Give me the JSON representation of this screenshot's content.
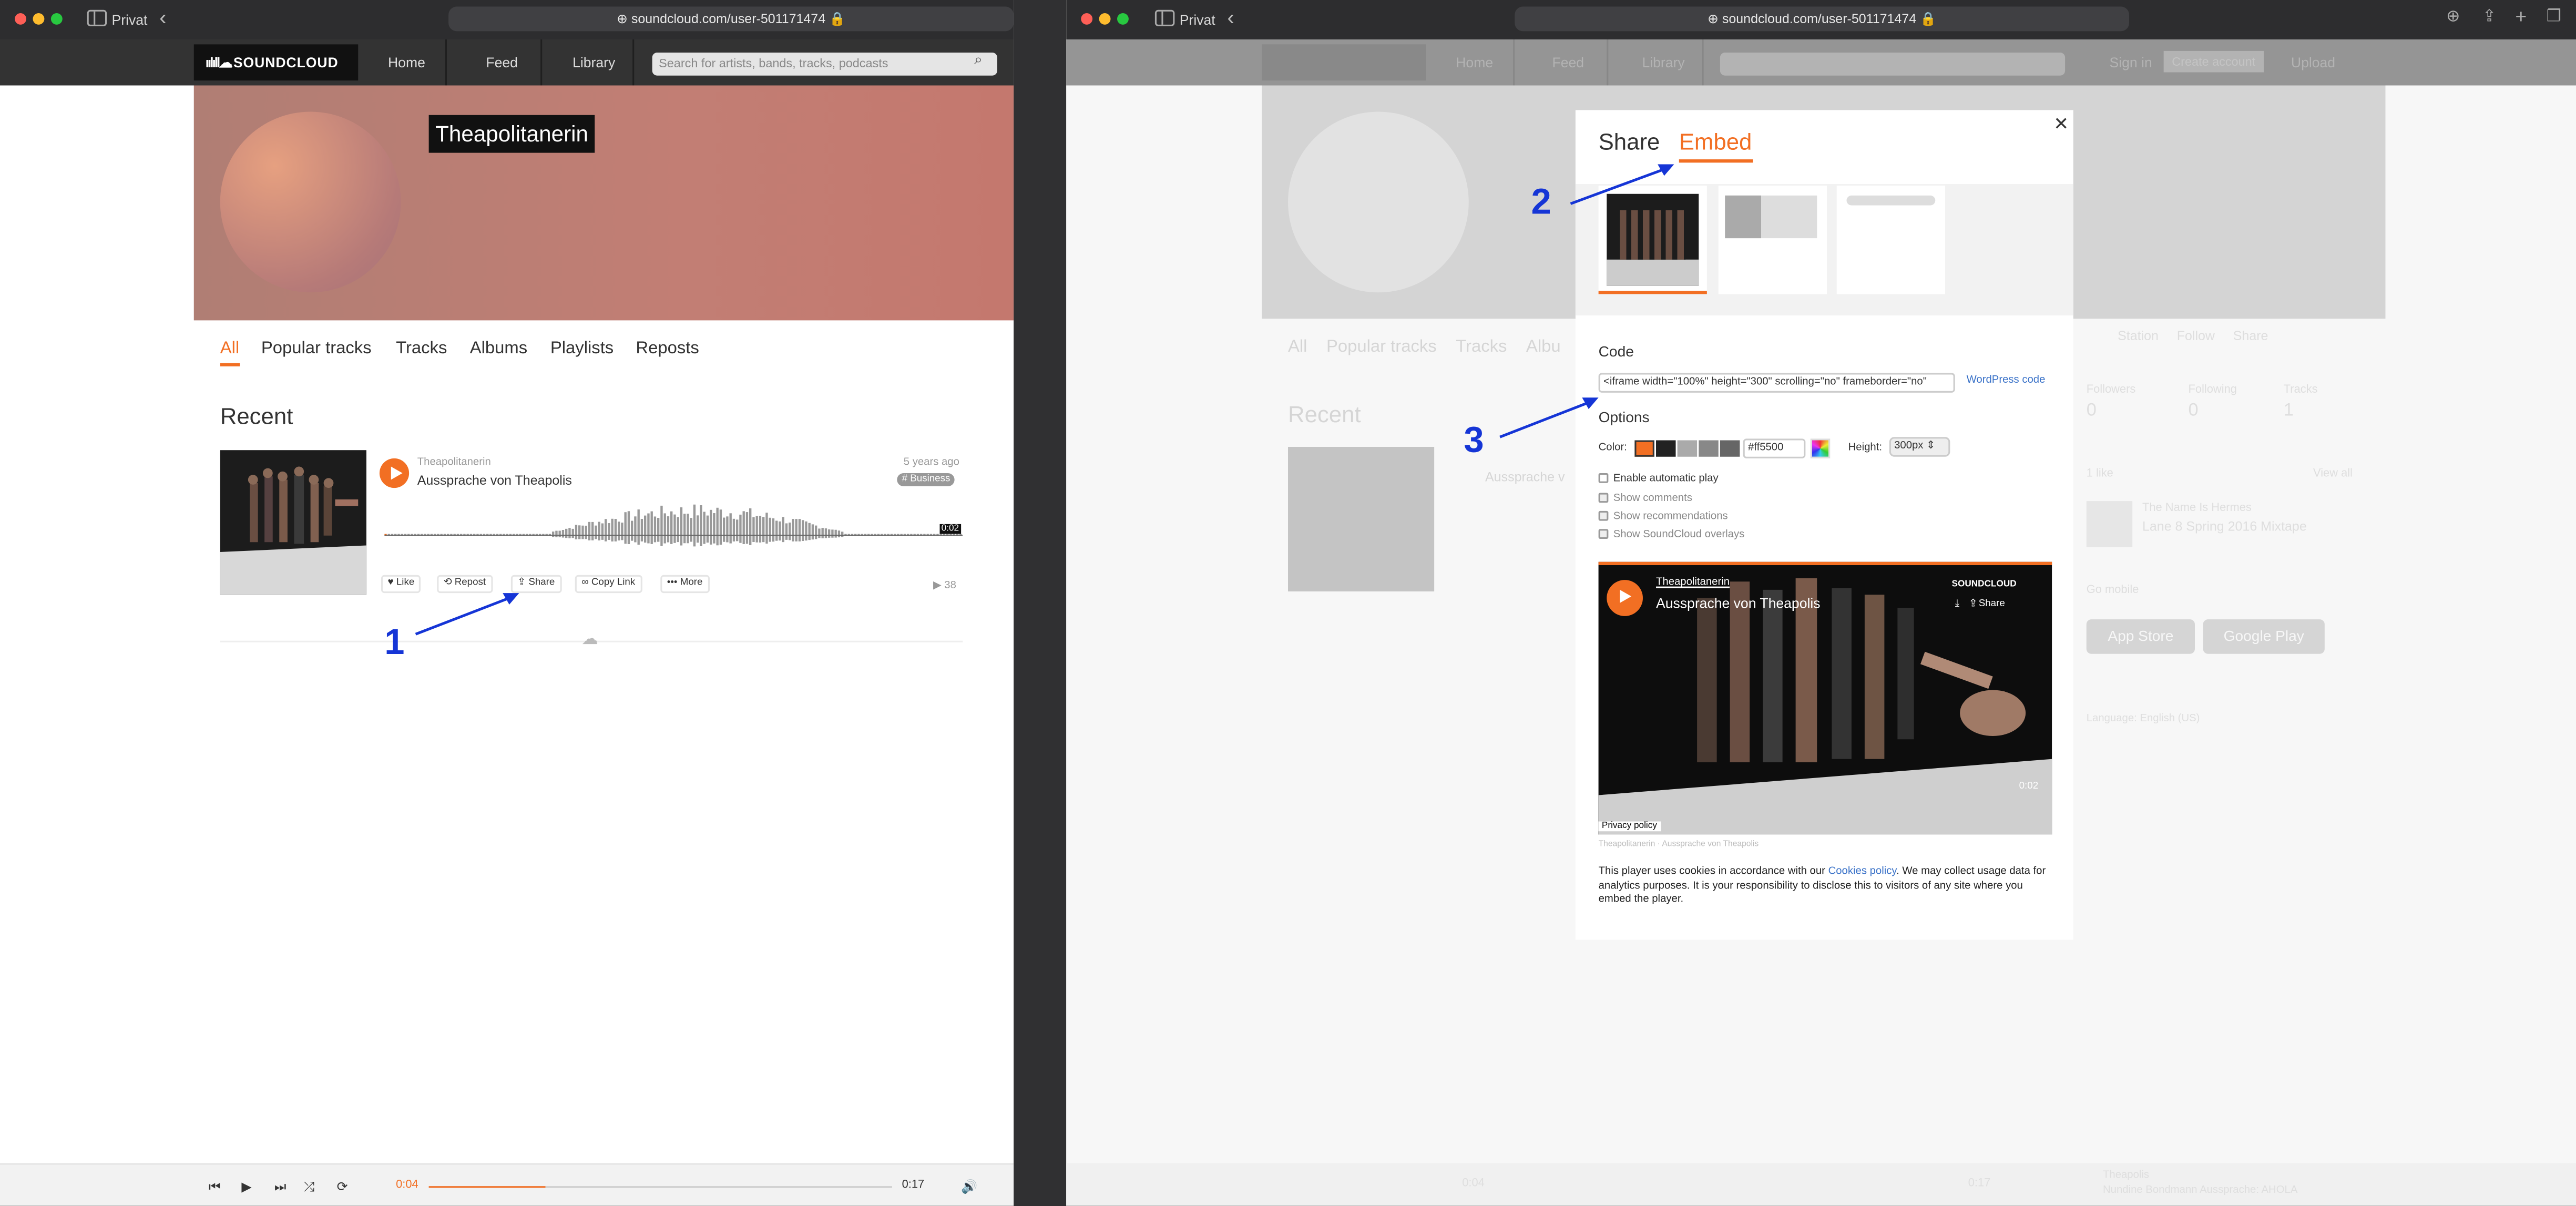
{
  "left_window": {
    "browser": {
      "private_label": "Privat",
      "url": "soundcloud.com/user-501171474"
    },
    "nav": {
      "logo": "SOUNDCLOUD",
      "items": [
        "Home",
        "Feed",
        "Library"
      ],
      "search_placeholder": "Search for artists, bands, tracks, podcasts"
    },
    "profile": {
      "username": "Theapolitanerin"
    },
    "tabs": [
      "All",
      "Popular tracks",
      "Tracks",
      "Albums",
      "Playlists",
      "Reposts"
    ],
    "recent_heading": "Recent",
    "track": {
      "artist": "Theapolitanerin",
      "title": "Aussprache von Theapolis",
      "age": "5 years ago",
      "tag": "# Business",
      "duration": "0:02",
      "plays": "38",
      "actions": [
        "Like",
        "Repost",
        "Share",
        "Copy Link",
        "More"
      ]
    },
    "player": {
      "elapsed": "0:04",
      "total": "0:17",
      "progress": 0.25
    }
  },
  "right_window": {
    "browser": {
      "private_label": "Privat",
      "url": "soundcloud.com/user-501171474"
    },
    "modal": {
      "tabs": [
        "Share",
        "Embed"
      ],
      "active_tab": "Embed",
      "code_label": "Code",
      "code_value": "<iframe width=\"100%\" height=\"300\" scrolling=\"no\" frameborder=\"no\"",
      "wordpress_link": "WordPress code",
      "options_label": "Options",
      "color_label": "Color:",
      "color_value": "#ff5500",
      "swatches": [
        "#f26f23",
        "#222222",
        "#aaaaaa",
        "#888888",
        "#666666",
        "#444444"
      ],
      "height_label": "Height:",
      "height_value": "300px",
      "checkboxes": [
        {
          "label": "Enable automatic play",
          "checked": false
        },
        {
          "label": "Show comments",
          "checked": true
        },
        {
          "label": "Show recommendations",
          "checked": true
        },
        {
          "label": "Show SoundCloud overlays",
          "checked": true
        }
      ],
      "preview": {
        "artist": "Theapolitanerin",
        "title": "Aussprache von Theapolis",
        "logo": "SOUNDCLOUD",
        "share": "Share",
        "duration": "0:02",
        "privacy": "Privacy policy",
        "caption": "Theapolitanerin · Aussprache von Theapolis"
      },
      "cookie_text_1": "This player uses cookies in accordance with our ",
      "cookie_link": "Cookies policy",
      "cookie_text_2": ". We may collect usage data for analytics purposes. It is your responsibility to disclose this to visitors of any site where you embed the player."
    },
    "background": {
      "nav": [
        "Home",
        "Feed",
        "Library"
      ],
      "signin": "Sign in",
      "create": "Create account",
      "upload": "Upload",
      "tabs": [
        "All",
        "Popular tracks",
        "Tracks",
        "Albu"
      ],
      "recent": "Recent",
      "track_partial": "Aussprache v",
      "side_tabs": [
        "Station",
        "Follow",
        "Share"
      ],
      "stats": [
        "Followers",
        "Following",
        "Tracks"
      ],
      "stat_values": [
        "0",
        "0",
        "1"
      ],
      "likes": "1 like",
      "view_all": "View all",
      "liked_artist": "The Name Is Hermes",
      "liked_title": "Lane 8 Spring 2016 Mixtape",
      "go_mobile": "Go mobile",
      "app_store": "App Store",
      "google_play": "Google Play",
      "language": "Language: English (US)",
      "player_elapsed": "0:04",
      "player_total": "0:17",
      "player_artist": "Theapolis",
      "player_track": "Nundine Bondmann Aussprache: AHOLA"
    }
  },
  "annotations": [
    "1",
    "2",
    "3"
  ],
  "colors": {
    "accent": "#f26f23",
    "annotation_blue": "#1535d6"
  }
}
